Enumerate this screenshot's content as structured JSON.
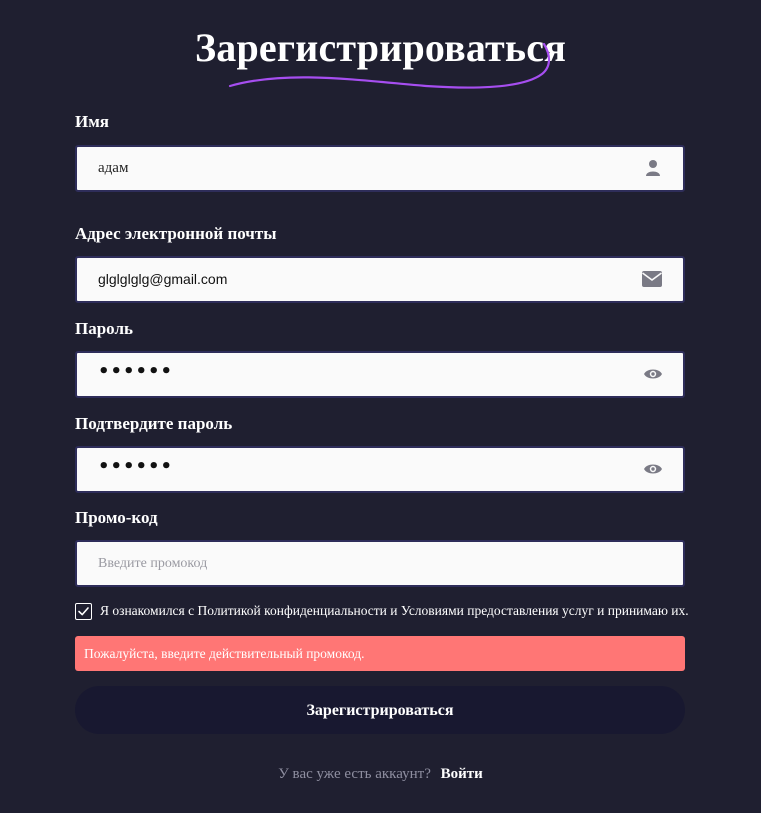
{
  "header": {
    "title": "Зарегистрироваться",
    "accent_color": "#a64ef0"
  },
  "form": {
    "name": {
      "label": "Имя",
      "value": "адам",
      "icon": "user-icon"
    },
    "email": {
      "label": "Адрес электронной почты",
      "value": "glglglglg@gmail.com",
      "icon": "envelope-icon"
    },
    "password": {
      "label": "Пароль",
      "value": "••••••",
      "icon": "eye-icon"
    },
    "confirm_password": {
      "label": "Подтвердите пароль",
      "value": "••••••",
      "icon": "eye-icon"
    },
    "promo": {
      "label": "Промо-код",
      "placeholder": "Введите промокод",
      "value": ""
    },
    "terms": {
      "checked": true,
      "label": "Я ознакомился с Политикой конфиденциальности и Условиями предоставления услуг и принимаю их."
    },
    "error": {
      "message": "Пожалуйста, введите действительный промокод.",
      "color": "#ff7675"
    },
    "submit_label": "Зарегистрироваться"
  },
  "footer": {
    "question": "У вас уже есть аккаунт?",
    "login_label": "Войти"
  },
  "colors": {
    "background": "#1f1f30",
    "input_background": "#fafafa",
    "button_background": "#181830"
  }
}
